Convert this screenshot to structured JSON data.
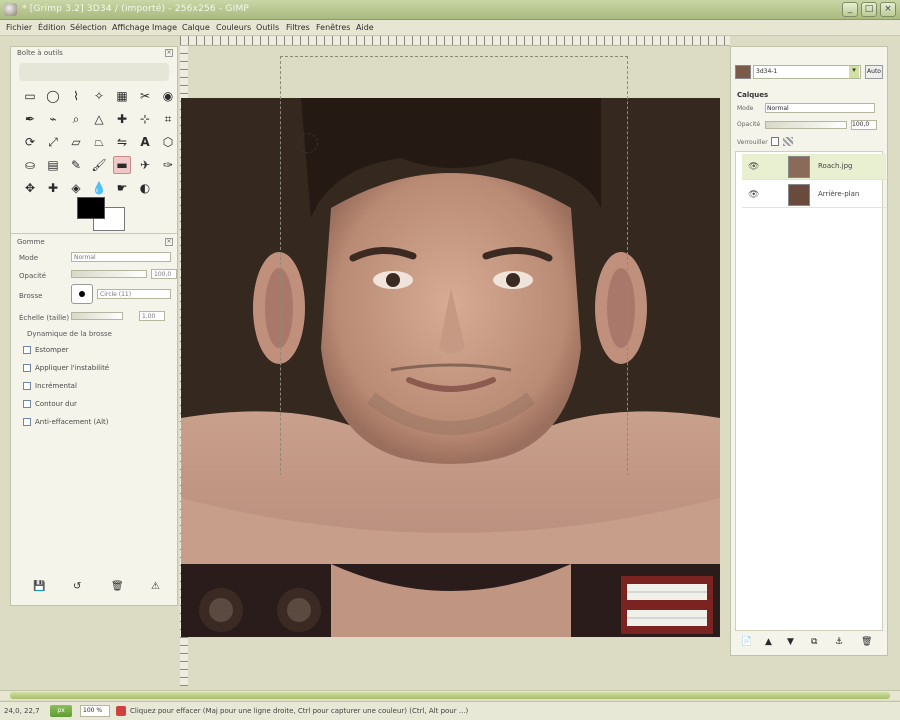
{
  "window": {
    "title": "* [Grimp 3.2] 3D34 / (importé) - 256x256 - GIMP",
    "buttons": [
      "_",
      "□",
      "×"
    ]
  },
  "menubar": {
    "items": [
      "Fichier",
      "Édition",
      "Sélection",
      "Affichage",
      "Image",
      "Calque",
      "Couleurs",
      "Outils",
      "Filtres",
      "Fenêtres",
      "Aide"
    ]
  },
  "toolbox": {
    "title": "Boîte à outils",
    "tool_icons": [
      "rect-select",
      "ellipse-select",
      "free-select",
      "fuzzy-select",
      "color-select",
      "scissors",
      "foreground-select",
      "paths",
      "color-picker",
      "zoom",
      "measure",
      "move",
      "align",
      "crop",
      "rotate",
      "scale",
      "shear",
      "perspective",
      "flip",
      "text",
      "cage",
      "bucket-fill",
      "blend",
      "pencil",
      "paintbrush",
      "eraser",
      "airbrush",
      "ink",
      "clone",
      "heal",
      "perspective-clone",
      "blur",
      "smudge",
      "dodge-burn"
    ],
    "active_tool": "eraser"
  },
  "tool_options": {
    "title": "Gomme",
    "mode_label": "Mode",
    "mode_value": "Normal",
    "opacity_label": "Opacité",
    "opacity_value": "100,0",
    "brush_label": "Brosse",
    "brush_value": "Circle (11)",
    "size_label": "Échelle (taille)",
    "size_value": "1,00",
    "dynamics_label": "Dynamique de la brosse",
    "checkboxes": [
      "Estomper",
      "Appliquer l'instabilité",
      "Incrémental",
      "Contour dur",
      "Anti-effacement (Alt)"
    ]
  },
  "layers": {
    "mode_label": "Mode",
    "mode_value": "Normal",
    "opacity_label": "Opacité",
    "opacity_value": "100,0",
    "lock_label": "Verrouiller",
    "image_select_value": "3d34-1",
    "auto_label": "Auto",
    "section_title": "Calques",
    "rows": [
      {
        "name": "Roach.jpg"
      },
      {
        "name": "Arrière-plan"
      }
    ]
  },
  "statusbar": {
    "coords": "24,0, 22,7",
    "unit": "px",
    "zoom": "100 %",
    "message": "Cliquez pour effacer (Maj pour une ligne droite, Ctrl pour capturer une couleur) (Ctrl, Alt pour ...)"
  },
  "colors": {
    "chrome": "#dcdcc4",
    "titlebar": "#b5c48c",
    "accent": "#8bbf5a"
  }
}
